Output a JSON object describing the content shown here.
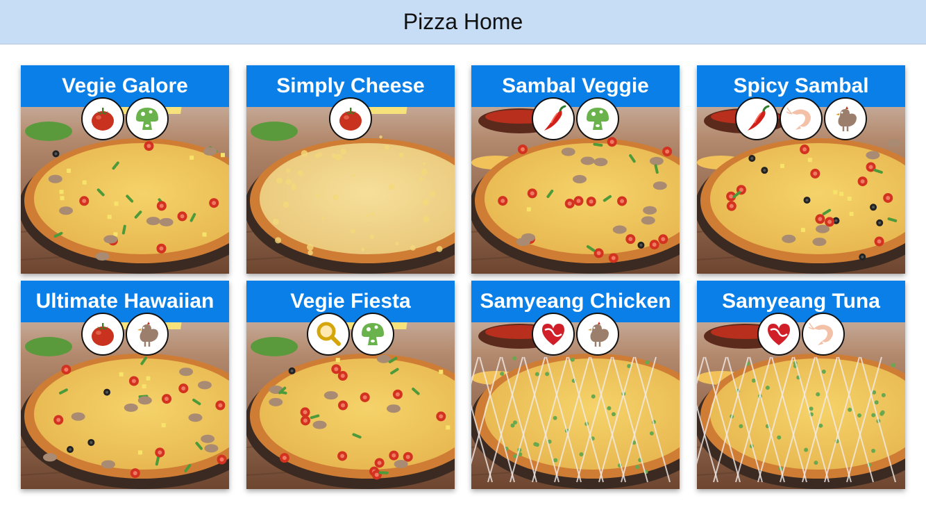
{
  "nav": {
    "title": "Pizza Home"
  },
  "pizzas": [
    {
      "name": "Vegie Galore",
      "ingredients": [
        "tomato-icon",
        "mushroom-icon"
      ],
      "base": "veg"
    },
    {
      "name": "Simply Cheese",
      "ingredients": [
        "tomato-icon"
      ],
      "base": "cheese"
    },
    {
      "name": "Sambal Veggie",
      "ingredients": [
        "chili-icon",
        "mushroom-icon"
      ],
      "base": "veg"
    },
    {
      "name": "Spicy Sambal",
      "ingredients": [
        "chili-icon",
        "shrimp-icon",
        "chicken-icon"
      ],
      "base": "sambal"
    },
    {
      "name": "Ultimate Hawaiian",
      "ingredients": [
        "tomato-icon",
        "chicken-icon"
      ],
      "base": "hawaiian"
    },
    {
      "name": "Vegie Fiesta",
      "ingredients": [
        "magnifier-icon",
        "mushroom-icon"
      ],
      "base": "veg"
    },
    {
      "name": "Samyeang Chicken",
      "ingredients": [
        "heart-sauce-icon",
        "chicken-icon"
      ],
      "base": "drizzle"
    },
    {
      "name": "Samyeang Tuna",
      "ingredients": [
        "heart-sauce-icon",
        "shrimp-icon"
      ],
      "base": "drizzle"
    }
  ],
  "colors": {
    "header_blue": "#0b7fe8",
    "navbar_bg": "#c7ddf6",
    "tomato": "#c8321e",
    "mushroom": "#6ab24c",
    "chicken": "#9b7f6c",
    "shrimp": "#f3c1a8"
  }
}
